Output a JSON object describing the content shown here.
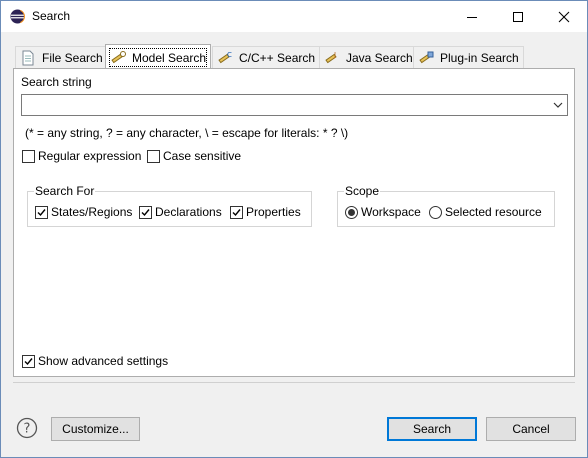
{
  "window": {
    "title": "Search"
  },
  "tabs": [
    {
      "label": "File Search",
      "icon": "file-search-icon"
    },
    {
      "label": "Model Search",
      "icon": "model-search-icon",
      "active": true
    },
    {
      "label": "C/C++ Search",
      "icon": "cpp-search-icon"
    },
    {
      "label": "Java Search",
      "icon": "java-search-icon"
    },
    {
      "label": "Plug-in Search",
      "icon": "plugin-search-icon"
    }
  ],
  "form": {
    "search_string_label": "Search string",
    "search_string_value": "",
    "hint": "(* = any string, ? = any character, \\ = escape for literals: * ? \\)",
    "regular_expression": {
      "label": "Regular expression",
      "checked": false
    },
    "case_sensitive": {
      "label": "Case sensitive",
      "checked": false
    }
  },
  "search_for": {
    "title": "Search For",
    "options": [
      {
        "label": "States/Regions",
        "checked": true
      },
      {
        "label": "Declarations",
        "checked": true
      },
      {
        "label": "Properties",
        "checked": true
      }
    ]
  },
  "scope": {
    "title": "Scope",
    "options": [
      {
        "label": "Workspace",
        "selected": true
      },
      {
        "label": "Selected resource",
        "selected": false
      }
    ]
  },
  "advanced": {
    "label": "Show advanced settings",
    "checked": true
  },
  "buttons": {
    "customize": "Customize...",
    "search": "Search",
    "cancel": "Cancel"
  },
  "colors": {
    "accent": "#0078d7",
    "frame": "#6b8cb8"
  }
}
